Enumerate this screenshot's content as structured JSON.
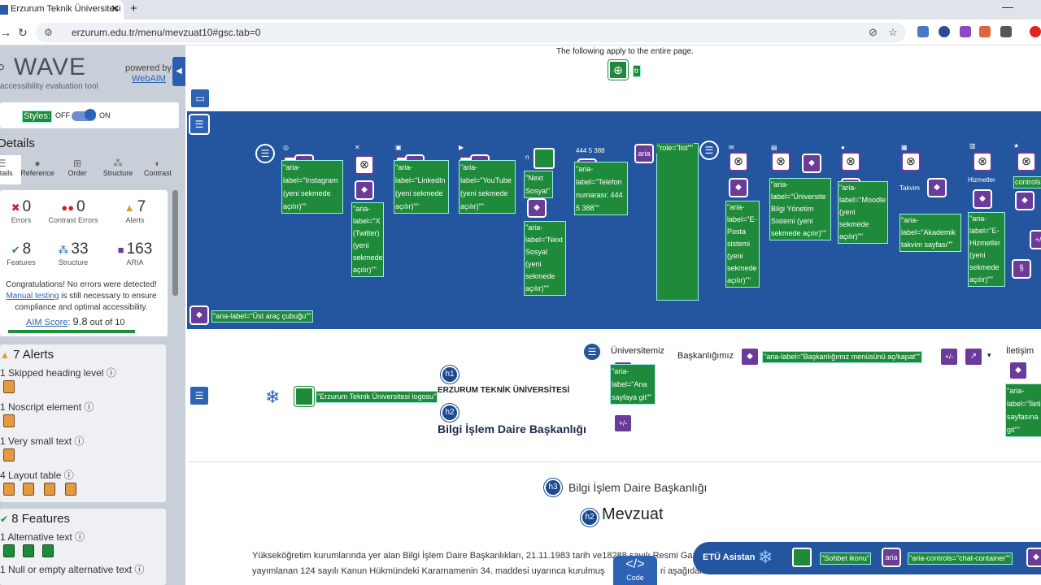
{
  "browser": {
    "tab_title": "Erzurum Teknik Üniversitesi",
    "new_tab": "+",
    "url": "erzurum.edu.tr/menu/mevzuat10#gsc.tab=0"
  },
  "wave": {
    "logo": "WAVE",
    "subtitle": "accessibility evaluation tool",
    "powered_by": "powered by",
    "webaim": "WebAIM",
    "styles_label": "Styles:",
    "styles_off": "OFF",
    "styles_on": "ON",
    "details_heading": "Details",
    "tabs": [
      "Details",
      "Reference",
      "Order",
      "Structure",
      "Contrast"
    ],
    "stats": [
      {
        "value": "0",
        "label": "Errors"
      },
      {
        "value": "0",
        "label": "Contrast Errors"
      },
      {
        "value": "7",
        "label": "Alerts"
      },
      {
        "value": "8",
        "label": "Features"
      },
      {
        "value": "33",
        "label": "Structure"
      },
      {
        "value": "163",
        "label": "ARIA"
      }
    ],
    "congrats": "Congratulations! No errors were detected!",
    "manual_link": "Manual testing",
    "manual_rest": "is still necessary to ensure compliance and optimal accessibility.",
    "aim_label": "AIM Score",
    "aim_score": "9.8",
    "aim_out_of": "out of 10",
    "alerts_heading": "7 Alerts",
    "alerts": [
      "1 Skipped heading level",
      "1 Noscript element",
      "1 Very small text",
      "4 Layout table"
    ],
    "features_heading": "8 Features",
    "features": [
      "1 Alternative text",
      "1 Null or empty alternative text"
    ]
  },
  "page": {
    "entire_page": "The following apply to the entire page.",
    "lang_label": "tr",
    "top_labels": {
      "instagram": "\"aria-label=\"Instagram (yeni sekmede açılır)\"\"",
      "twitter": "\"aria-label=\"X (Twitter) (yeni sekmede açılır)\"\"",
      "linkedin": "\"aria-label=\"LinkedIn (yeni sekmede açılır)\"\"",
      "youtube": "\"aria-label=\"YouTube (yeni sekmede açılır)\"\"",
      "next_sosyal_a": "\"Next Sosyal\"",
      "next_sosyal_b": "\"aria-label=\"Next Sosyal (yeni sekmede açılır)\"\"",
      "phone_text": "444 5 388",
      "telefon": "\"aria-label=\"Telefon numarası: 444 5 388\"\"",
      "role_list": "\"role=\"list\"\"",
      "eposta": "\"aria-label=\"E-Posta sistemi (yeni sekmede açılır)\"\"",
      "ubys": "\"aria-label=\"Üniversite Bilgi Yönetim Sistemi (yeni sekmede açılır)\"\"",
      "moodle": "\"aria-label=\"Moodle (yeni sekmede açılır)\"\"",
      "takvim_text": "Takvim",
      "akademik": "\"aria-label=\"Akademik takvim sayfası\"\"",
      "hizmetler_text": "Hizmetler",
      "ehizmetler": "\"aria-label=\"E-Hizmetler (yeni sekmede açılır)\"\"",
      "controls": "controls",
      "ust_arac": "\"aria-label=\"Üst araç çubuğu\"\""
    },
    "header": {
      "logo_alt": "\"Erzurum Teknik Üniversitesi logosu\"",
      "university": "ERZURUM TEKNİK ÜNİVERSİTESİ",
      "dept": "Bilgi İşlem Daire Başkanlığı",
      "universitemiz": "Üniversitemiz",
      "ana_sayfa": "\"aria-label=\"Ana sayfaya git\"\"",
      "baskanligimiz": "Başkanlığımız",
      "baskanlik_label": "\"aria-label=\"Başkanlığımız menüsünü aç/kapat\"\"",
      "iletisim": "İletişim",
      "iletisim_label": "\"aria-label=\"İletişim sayfasına git\"\""
    },
    "content": {
      "h3": "Bilgi İşlem Daire Başkanlığı",
      "h2": "Mevzuat",
      "para1": "Yükseköğretim kurumlarında yer alan Bilgi İşlem Daire Başkanlıkları, 21.11.1983 tarih ve18288 sayılı Resmi Gaz",
      "para2": "yayımlanan 124 sayılı Kanun Hükmündeki Kararnamenin 34. maddesi uyarınca kurulmuş",
      "para2_end": "ri aşağıdaki"
    },
    "chat": {
      "title": "ETÜ Asistan",
      "sohbet": "\"Sohbet ikonu\"",
      "aria_icon": "aria",
      "controls_label": "\"aria-controls=\"chat-container\"\""
    },
    "code_button": "Code"
  }
}
